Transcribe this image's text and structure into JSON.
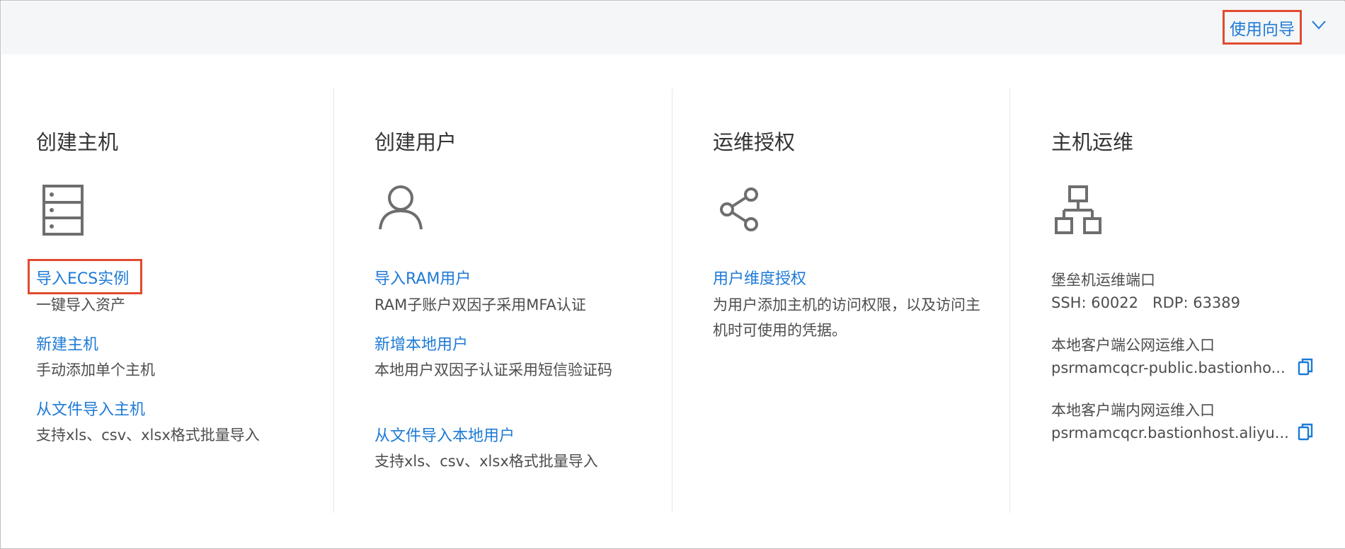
{
  "header": {
    "guide_label": "使用向导"
  },
  "columns": [
    {
      "title": "创建主机",
      "items": [
        {
          "link": "导入ECS实例",
          "desc": "一键导入资产"
        },
        {
          "link": "新建主机",
          "desc": "手动添加单个主机"
        },
        {
          "link": "从文件导入主机",
          "desc": "支持xls、csv、xlsx格式批量导入"
        }
      ]
    },
    {
      "title": "创建用户",
      "items": [
        {
          "link": "导入RAM用户",
          "desc": "RAM子账户双因子采用MFA认证"
        },
        {
          "link": "新增本地用户",
          "desc": "本地用户双因子认证采用短信验证码"
        },
        {
          "link": "从文件导入本地用户",
          "desc": "支持xls、csv、xlsx格式批量导入"
        }
      ]
    },
    {
      "title": "运维授权",
      "items": [
        {
          "link": "用户维度授权",
          "desc": "为用户添加主机的访问权限，以及访问主机时可使用的凭据。"
        }
      ]
    },
    {
      "title": "主机运维",
      "port_label": "堡垒机运维端口",
      "port_values": "SSH: 60022   RDP: 63389",
      "public_label": "本地客户端公网运维入口",
      "public_value": "psrmamcqcr-public.bastionho...",
      "private_label": "本地客户端内网运维入口",
      "private_value": "psrmamcqcr.bastionhost.aliyu..."
    }
  ],
  "colors": {
    "link": "#1e7ad6",
    "highlight": "#e04b2f",
    "icon": "#6e6e6e"
  }
}
